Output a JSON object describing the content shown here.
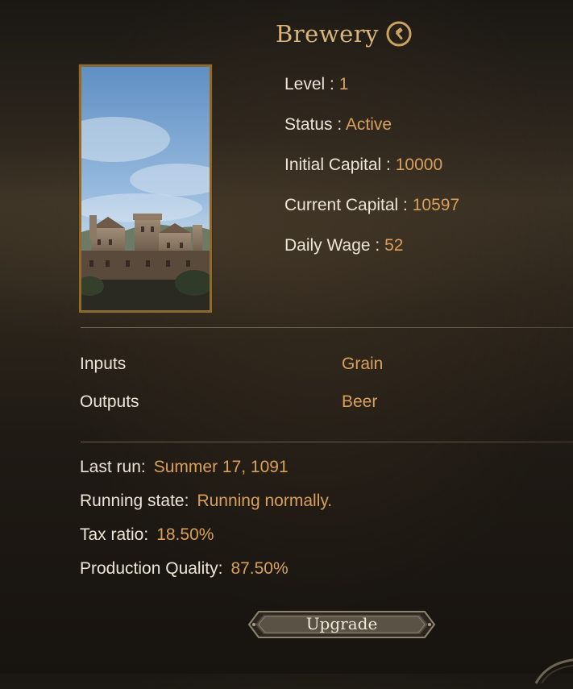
{
  "header": {
    "title": "Brewery",
    "icon": "change-workshop-icon"
  },
  "stats": {
    "level_label": "Level :",
    "level_value": "1",
    "status_label": "Status :",
    "status_value": "Active",
    "initial_capital_label": "Initial Capital :",
    "initial_capital_value": "10000",
    "current_capital_label": "Current Capital :",
    "current_capital_value": "10597",
    "daily_wage_label": "Daily Wage :",
    "daily_wage_value": "52"
  },
  "production": {
    "inputs_label": "Inputs",
    "inputs_value": "Grain",
    "outputs_label": "Outputs",
    "outputs_value": "Beer"
  },
  "info": {
    "last_run_label": "Last run:",
    "last_run_value": "Summer 17, 1091",
    "running_state_label": "Running state:",
    "running_state_value": "Running normally.",
    "tax_ratio_label": "Tax ratio:",
    "tax_ratio_value": "18.50%",
    "production_quality_label": "Production Quality:",
    "production_quality_value": "87.50%"
  },
  "actions": {
    "upgrade_label": "Upgrade"
  },
  "colors": {
    "title": "#d8b57a",
    "value": "#d9a05c",
    "label": "#ece4d6",
    "frame": "#8a6a35"
  }
}
